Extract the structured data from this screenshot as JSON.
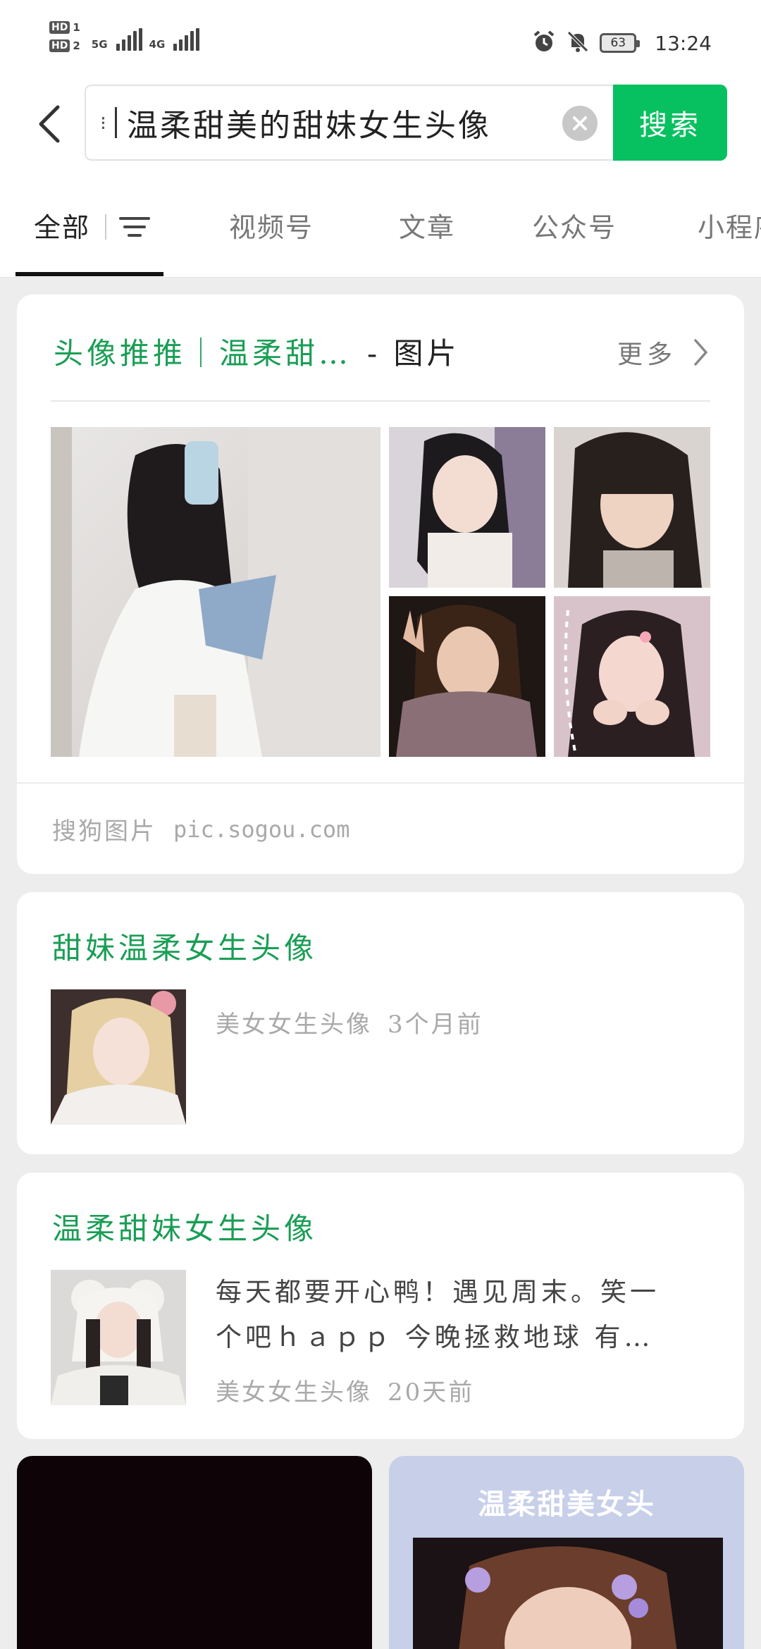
{
  "status_bar": {
    "hd1": "HD",
    "hd1_num": "1",
    "hd2": "HD",
    "hd2_num": "2",
    "net1": "5G",
    "net2": "4G",
    "battery": "63",
    "time": "13:24"
  },
  "search": {
    "overflow_indicator": "⁝",
    "query": "温柔甜美的甜妹女生头像",
    "button_label": "搜索"
  },
  "tabs": [
    {
      "label": "全部"
    },
    {
      "label": "视频号"
    },
    {
      "label": "文章"
    },
    {
      "label": "公众号"
    },
    {
      "label": "小程序"
    }
  ],
  "image_card": {
    "title": "头像推推｜温柔甜…",
    "title_suffix": "- 图片",
    "more": "更多",
    "source_name": "搜狗图片",
    "source_url": "pic.sogou.com"
  },
  "articles": [
    {
      "title": "甜妹温柔女生头像",
      "snippet": "",
      "account": "美女女生头像",
      "time": "3个月前"
    },
    {
      "title": "温柔甜妹女生头像",
      "snippet_line1": "每天都要开心鸭！遇见周末。笑一",
      "snippet_line2": "个吧ｈａｐｐ 今晚拯救地球 有…",
      "account": "美女女生头像",
      "time": "20天前"
    }
  ],
  "video_cards": [
    {
      "overlay_text": ""
    },
    {
      "overlay_text": "温柔甜美女头"
    }
  ],
  "colors": {
    "accent_green": "#07c160",
    "title_green": "#1a9e55",
    "background": "#ededed"
  }
}
